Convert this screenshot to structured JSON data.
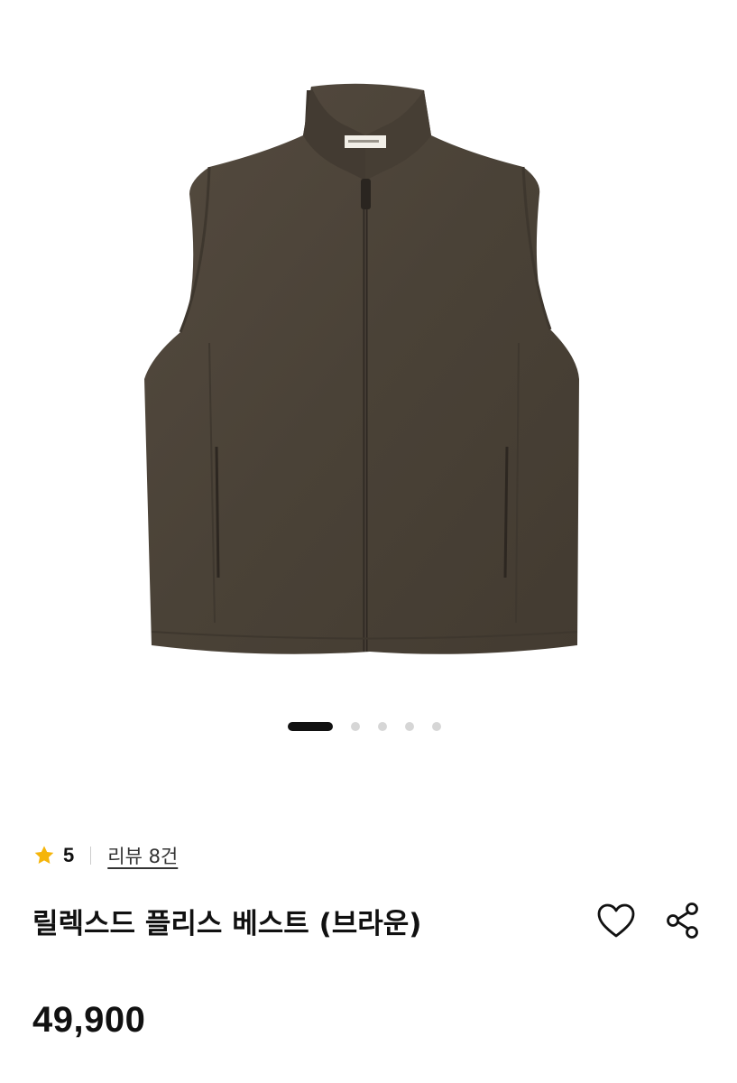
{
  "gallery": {
    "image_alt": "vest-product-photo",
    "garment_color": "#4a4237",
    "page_count": 5,
    "active_page": 1
  },
  "rating": {
    "icon": "star-icon",
    "star_color": "#f5b50a",
    "value": "5",
    "review_link": "리뷰 8건"
  },
  "product": {
    "title": "릴렉스드 플리스 베스트 (브라운)",
    "price": "49,900"
  },
  "actions": {
    "like_icon": "heart-icon",
    "share_icon": "share-icon"
  }
}
